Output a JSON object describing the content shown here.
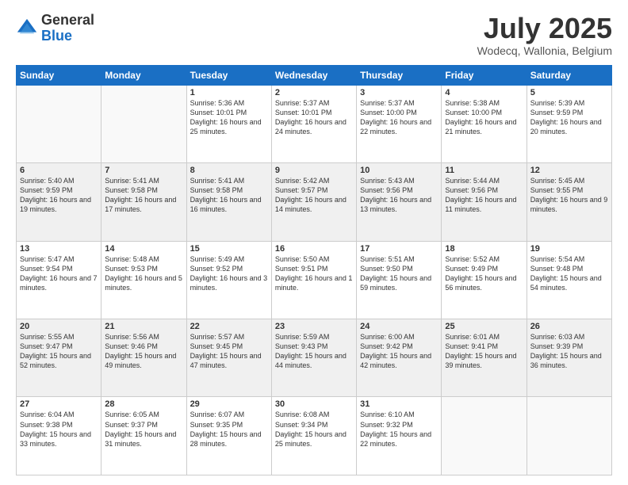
{
  "logo": {
    "general": "General",
    "blue": "Blue"
  },
  "title": "July 2025",
  "location": "Wodecq, Wallonia, Belgium",
  "headers": [
    "Sunday",
    "Monday",
    "Tuesday",
    "Wednesday",
    "Thursday",
    "Friday",
    "Saturday"
  ],
  "weeks": [
    [
      {
        "day": "",
        "info": ""
      },
      {
        "day": "",
        "info": ""
      },
      {
        "day": "1",
        "info": "Sunrise: 5:36 AM\nSunset: 10:01 PM\nDaylight: 16 hours and 25 minutes."
      },
      {
        "day": "2",
        "info": "Sunrise: 5:37 AM\nSunset: 10:01 PM\nDaylight: 16 hours and 24 minutes."
      },
      {
        "day": "3",
        "info": "Sunrise: 5:37 AM\nSunset: 10:00 PM\nDaylight: 16 hours and 22 minutes."
      },
      {
        "day": "4",
        "info": "Sunrise: 5:38 AM\nSunset: 10:00 PM\nDaylight: 16 hours and 21 minutes."
      },
      {
        "day": "5",
        "info": "Sunrise: 5:39 AM\nSunset: 9:59 PM\nDaylight: 16 hours and 20 minutes."
      }
    ],
    [
      {
        "day": "6",
        "info": "Sunrise: 5:40 AM\nSunset: 9:59 PM\nDaylight: 16 hours and 19 minutes."
      },
      {
        "day": "7",
        "info": "Sunrise: 5:41 AM\nSunset: 9:58 PM\nDaylight: 16 hours and 17 minutes."
      },
      {
        "day": "8",
        "info": "Sunrise: 5:41 AM\nSunset: 9:58 PM\nDaylight: 16 hours and 16 minutes."
      },
      {
        "day": "9",
        "info": "Sunrise: 5:42 AM\nSunset: 9:57 PM\nDaylight: 16 hours and 14 minutes."
      },
      {
        "day": "10",
        "info": "Sunrise: 5:43 AM\nSunset: 9:56 PM\nDaylight: 16 hours and 13 minutes."
      },
      {
        "day": "11",
        "info": "Sunrise: 5:44 AM\nSunset: 9:56 PM\nDaylight: 16 hours and 11 minutes."
      },
      {
        "day": "12",
        "info": "Sunrise: 5:45 AM\nSunset: 9:55 PM\nDaylight: 16 hours and 9 minutes."
      }
    ],
    [
      {
        "day": "13",
        "info": "Sunrise: 5:47 AM\nSunset: 9:54 PM\nDaylight: 16 hours and 7 minutes."
      },
      {
        "day": "14",
        "info": "Sunrise: 5:48 AM\nSunset: 9:53 PM\nDaylight: 16 hours and 5 minutes."
      },
      {
        "day": "15",
        "info": "Sunrise: 5:49 AM\nSunset: 9:52 PM\nDaylight: 16 hours and 3 minutes."
      },
      {
        "day": "16",
        "info": "Sunrise: 5:50 AM\nSunset: 9:51 PM\nDaylight: 16 hours and 1 minute."
      },
      {
        "day": "17",
        "info": "Sunrise: 5:51 AM\nSunset: 9:50 PM\nDaylight: 15 hours and 59 minutes."
      },
      {
        "day": "18",
        "info": "Sunrise: 5:52 AM\nSunset: 9:49 PM\nDaylight: 15 hours and 56 minutes."
      },
      {
        "day": "19",
        "info": "Sunrise: 5:54 AM\nSunset: 9:48 PM\nDaylight: 15 hours and 54 minutes."
      }
    ],
    [
      {
        "day": "20",
        "info": "Sunrise: 5:55 AM\nSunset: 9:47 PM\nDaylight: 15 hours and 52 minutes."
      },
      {
        "day": "21",
        "info": "Sunrise: 5:56 AM\nSunset: 9:46 PM\nDaylight: 15 hours and 49 minutes."
      },
      {
        "day": "22",
        "info": "Sunrise: 5:57 AM\nSunset: 9:45 PM\nDaylight: 15 hours and 47 minutes."
      },
      {
        "day": "23",
        "info": "Sunrise: 5:59 AM\nSunset: 9:43 PM\nDaylight: 15 hours and 44 minutes."
      },
      {
        "day": "24",
        "info": "Sunrise: 6:00 AM\nSunset: 9:42 PM\nDaylight: 15 hours and 42 minutes."
      },
      {
        "day": "25",
        "info": "Sunrise: 6:01 AM\nSunset: 9:41 PM\nDaylight: 15 hours and 39 minutes."
      },
      {
        "day": "26",
        "info": "Sunrise: 6:03 AM\nSunset: 9:39 PM\nDaylight: 15 hours and 36 minutes."
      }
    ],
    [
      {
        "day": "27",
        "info": "Sunrise: 6:04 AM\nSunset: 9:38 PM\nDaylight: 15 hours and 33 minutes."
      },
      {
        "day": "28",
        "info": "Sunrise: 6:05 AM\nSunset: 9:37 PM\nDaylight: 15 hours and 31 minutes."
      },
      {
        "day": "29",
        "info": "Sunrise: 6:07 AM\nSunset: 9:35 PM\nDaylight: 15 hours and 28 minutes."
      },
      {
        "day": "30",
        "info": "Sunrise: 6:08 AM\nSunset: 9:34 PM\nDaylight: 15 hours and 25 minutes."
      },
      {
        "day": "31",
        "info": "Sunrise: 6:10 AM\nSunset: 9:32 PM\nDaylight: 15 hours and 22 minutes."
      },
      {
        "day": "",
        "info": ""
      },
      {
        "day": "",
        "info": ""
      }
    ]
  ]
}
